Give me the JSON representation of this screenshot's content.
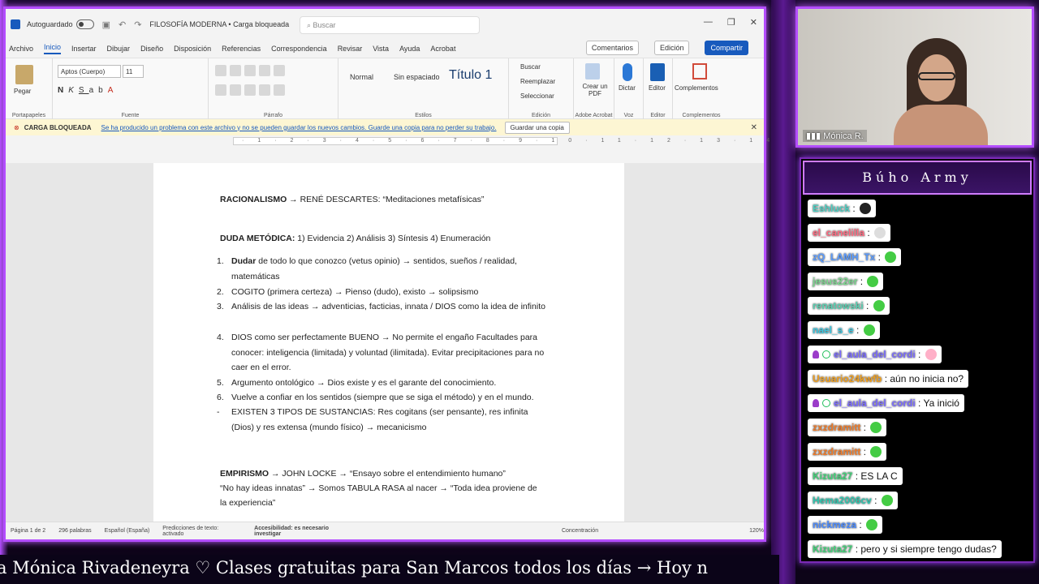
{
  "word": {
    "autosave_label": "Autoguardado",
    "doc_title": "FILOSOFÍA MODERNA • Carga bloqueada",
    "search_placeholder": "Buscar",
    "menu": [
      "Archivo",
      "Inicio",
      "Insertar",
      "Dibujar",
      "Diseño",
      "Disposición",
      "Referencias",
      "Correspondencia",
      "Revisar",
      "Vista",
      "Ayuda",
      "Acrobat"
    ],
    "right_buttons": {
      "comments": "Comentarios",
      "edit": "Edición",
      "share": "Compartir"
    },
    "ribbon": {
      "paste": "Pegar",
      "clipboard": "Portapapeles",
      "font_name": "Aptos (Cuerpo)",
      "font_size": "11",
      "font_group": "Fuente",
      "paragraph_group": "Párrafo",
      "style_normal": "Normal",
      "style_nospace": "Sin espaciado",
      "style_title": "Título 1",
      "styles_group": "Estilos",
      "find": "Buscar",
      "replace": "Reemplazar",
      "select": "Seleccionar",
      "edit_group": "Edición",
      "create_pdf": "Crear un PDF",
      "adobe_group": "Adobe Acrobat",
      "dictate": "Dictar",
      "voice_group": "Voz",
      "editor": "Editor",
      "editor_group": "Editor",
      "addins": "Complementos",
      "addins_group": "Complementos"
    },
    "notification": {
      "title": "CARGA BLOQUEADA",
      "message": "Se ha producido un problema con este archivo y no se pueden guardar los nuevos cambios. Guarde una copia para no perder su trabajo.",
      "button": "Guardar una copia"
    },
    "document": {
      "rac_bold": "RACIONALISMO",
      "rac_rest": " → RENÉ DESCARTES: “Meditaciones metafísicas”",
      "duda_bold": "DUDA METÓDICA:",
      "duda_rest": " 1) Evidencia 2) Análisis 3) Síntesis 4) Enumeración",
      "items": [
        {
          "n": "1.",
          "bold": "Dudar",
          "text": " de todo lo que conozco (vetus opinio) → sentidos, sueños / realidad, matemáticas"
        },
        {
          "n": "2.",
          "bold": "",
          "text": "COGITO (primera certeza) → Pienso (dudo), existo → solipsismo"
        },
        {
          "n": "3.",
          "bold": "",
          "text": "Análisis de las ideas → adventicias, facticias, innata / DIOS como la idea de infinito"
        },
        {
          "n": "4.",
          "bold": "",
          "text": "DIOS como ser perfectamente BUENO → No permite el engaño Facultades para conocer: inteligencia (limitada) y voluntad (ilimitada). Evitar precipitaciones para no caer en el error."
        },
        {
          "n": "5.",
          "bold": "",
          "text": "Argumento ontológico → Dios existe y es el garante del conocimiento."
        },
        {
          "n": "6.",
          "bold": "",
          "text": "Vuelve a confiar en los sentidos (siempre que se siga el método) y en el mundo."
        },
        {
          "n": "-",
          "bold": "",
          "text": "EXISTEN 3 TIPOS DE SUSTANCIAS: Res cogitans (ser pensante), res infinita (Dios) y res extensa (mundo físico) → mecanicismo"
        }
      ],
      "emp_bold": "EMPIRISMO",
      "emp_rest": " → JOHN LOCKE → “Ensayo sobre el entendimiento humano”",
      "emp_line2": "“No hay ideas innatas” → Somos TABULA RASA al nacer → “Toda idea proviene de la experiencia”"
    },
    "status": {
      "page": "Página 1 de 2",
      "words": "296 palabras",
      "lang": "Español (España)",
      "predict": "Predicciones de texto: activado",
      "access": "Accesibilidad: es necesario investigar",
      "focus": "Concentración",
      "zoom": "120%"
    }
  },
  "camera": {
    "name": "Mónica R."
  },
  "chat": {
    "title": "Búho Army",
    "messages": [
      {
        "user": "Eshluck",
        "color": "#4fd1c5",
        "text": " : ",
        "emote": "#222222"
      },
      {
        "user": "el_canelilla",
        "color": "#ff6b81",
        "text": " : ",
        "emote": "#dddddd"
      },
      {
        "user": "zQ_LAMH_Tx",
        "color": "#5b9cff",
        "text": " : ",
        "emote": "#44cc44"
      },
      {
        "user": "jesus22er",
        "color": "#7bd88f",
        "text": " : ",
        "emote": "#44cc44"
      },
      {
        "user": "renatowski",
        "color": "#5ad1b3",
        "text": " : ",
        "emote": "#44cc44"
      },
      {
        "user": "nael_s_e",
        "color": "#3cc7e0",
        "text": " : ",
        "emote": "#44cc44"
      },
      {
        "user": "el_aula_del_cordi",
        "color": "#7b6cff",
        "text": " : ",
        "emote": "#ffb0c8"
      },
      {
        "user": "Usuario24kwfb",
        "color": "#f0a020",
        "text": " : aún no inicia no?",
        "emote": ""
      },
      {
        "user": "el_aula_del_cordi",
        "color": "#7b6cff",
        "text": " : Ya inició",
        "emote": ""
      },
      {
        "user": "zxzdramitt",
        "color": "#f07c2a",
        "text": " : ",
        "emote": "#44cc44"
      },
      {
        "user": "zxzdramitt",
        "color": "#f07c2a",
        "text": " : ",
        "emote": "#44cc44"
      },
      {
        "user": "Kizuta27",
        "color": "#44d27a",
        "text": " : ES LA C",
        "emote": ""
      },
      {
        "user": "Hema2006cv",
        "color": "#2fc7b0",
        "text": " : ",
        "emote": "#44cc44"
      },
      {
        "user": "nickmeza",
        "color": "#4b8bff",
        "text": " : ",
        "emote": "#44cc44"
      },
      {
        "user": "Kizuta27",
        "color": "#44d27a",
        "text": " : pero y si siempre tengo dudas?",
        "emote": ""
      }
    ]
  },
  "ticker": {
    "text": "ra Mónica Rivadeneyra  ♡          Clases gratuitas para San Marcos todos los días  →  Hoy n"
  }
}
